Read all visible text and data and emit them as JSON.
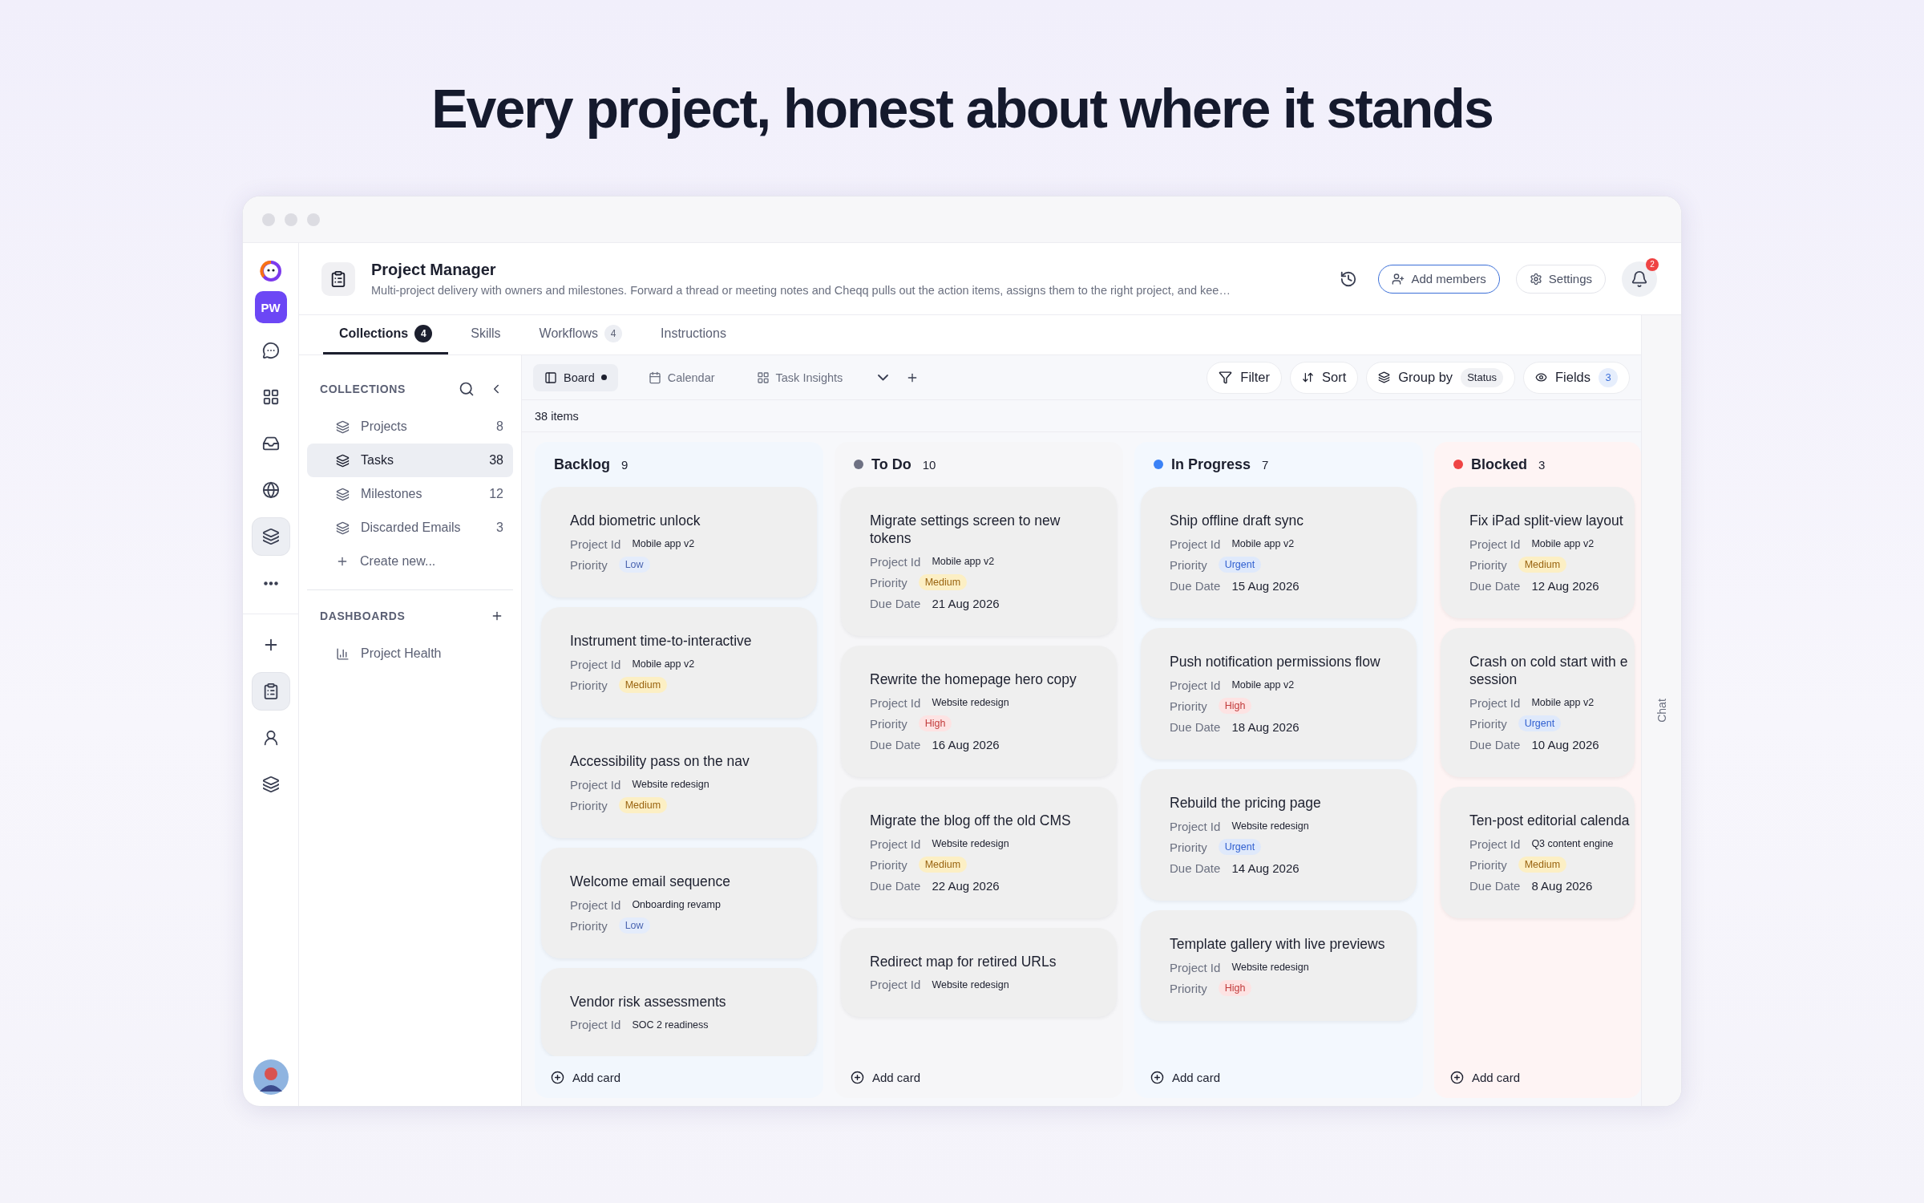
{
  "headline": "Every project, honest about where it stands",
  "rail": {
    "top": [
      {
        "kind": "logo"
      },
      {
        "kind": "initials",
        "text": "PW"
      },
      {
        "kind": "chat",
        "selected": false
      },
      {
        "kind": "grid",
        "selected": false
      },
      {
        "kind": "tray",
        "selected": false
      },
      {
        "kind": "globe",
        "selected": false
      },
      {
        "kind": "layers",
        "selected": true
      },
      {
        "kind": "more",
        "selected": false
      }
    ],
    "bottom": [
      {
        "kind": "plus",
        "selected": false
      },
      {
        "kind": "clipboard",
        "selected": true
      },
      {
        "kind": "user",
        "selected": false
      },
      {
        "kind": "layers",
        "selected": false
      }
    ]
  },
  "header": {
    "title": "Project Manager",
    "description": "Multi-project delivery with owners and milestones. Forward a thread or meeting notes and Cheqq pulls out the action items, assigns them to the right project, and kee…",
    "buttons": [
      "Add members",
      "Settings"
    ],
    "notifications": "2"
  },
  "tabs": [
    {
      "label": "Collections",
      "count": "4",
      "selected": true
    },
    {
      "label": "Skills",
      "selected": false
    },
    {
      "label": "Workflows",
      "count": "4",
      "selected": false
    },
    {
      "label": "Instructions",
      "selected": false
    }
  ],
  "sidebar": {
    "collections_title": "COLLECTIONS",
    "collections": [
      {
        "label": "Projects",
        "count": "8",
        "selected": false
      },
      {
        "label": "Tasks",
        "count": "38",
        "selected": true
      },
      {
        "label": "Milestones",
        "count": "12",
        "selected": false
      },
      {
        "label": "Discarded Emails",
        "count": "3",
        "selected": false
      }
    ],
    "create_label": "Create new...",
    "dashboards_title": "DASHBOARDS",
    "dashboards": [
      {
        "label": "Project Health"
      }
    ]
  },
  "views": [
    {
      "label": "Board",
      "kind": "board",
      "selected": true
    },
    {
      "label": "Calendar",
      "kind": "calendar",
      "selected": false
    },
    {
      "label": "Task Insights",
      "kind": "insights",
      "selected": false
    }
  ],
  "toolbar": [
    {
      "label": "Filter",
      "kind": "filter"
    },
    {
      "label": "Sort",
      "kind": "sort"
    },
    {
      "label": "Group by",
      "kind": "group",
      "chip": "Status"
    },
    {
      "label": "Fields",
      "kind": "fields",
      "chip": "3"
    }
  ],
  "item_count": "38 items",
  "columns": [
    {
      "name": "Backlog",
      "count": "9",
      "add_label": "Add card",
      "cards": [
        {
          "title": "Add biometric unlock",
          "fields": [
            {
              "label": "Project Id",
              "value": "Mobile app v2",
              "kind": "tag"
            },
            {
              "label": "Priority",
              "value": "Low",
              "kind": "low"
            }
          ]
        },
        {
          "title": "Instrument time-to-interactive",
          "fields": [
            {
              "label": "Project Id",
              "value": "Mobile app v2",
              "kind": "tag"
            },
            {
              "label": "Priority",
              "value": "Medium",
              "kind": "medium"
            }
          ]
        },
        {
          "title": "Accessibility pass on the nav",
          "fields": [
            {
              "label": "Project Id",
              "value": "Website redesign",
              "kind": "tag"
            },
            {
              "label": "Priority",
              "value": "Medium",
              "kind": "medium"
            }
          ]
        },
        {
          "title": "Welcome email sequence",
          "fields": [
            {
              "label": "Project Id",
              "value": "Onboarding revamp",
              "kind": "tag"
            },
            {
              "label": "Priority",
              "value": "Low",
              "kind": "low"
            }
          ]
        },
        {
          "title": "Vendor risk assessments",
          "fields": [
            {
              "label": "Project Id",
              "value": "SOC 2 readiness",
              "kind": "tag"
            }
          ]
        }
      ]
    },
    {
      "name": "To Do",
      "count": "10",
      "color": "#6e7183",
      "add_label": "Add card",
      "cards": [
        {
          "title": "Migrate settings screen to new tokens",
          "fields": [
            {
              "label": "Project Id",
              "value": "Mobile app v2",
              "kind": "tag"
            },
            {
              "label": "Priority",
              "value": "Medium",
              "kind": "medium"
            },
            {
              "label": "Due Date",
              "value": "21 Aug 2026",
              "kind": "plain"
            }
          ]
        },
        {
          "title": "Rewrite the homepage hero copy",
          "fields": [
            {
              "label": "Project Id",
              "value": "Website redesign",
              "kind": "tag"
            },
            {
              "label": "Priority",
              "value": "High",
              "kind": "high"
            },
            {
              "label": "Due Date",
              "value": "16 Aug 2026",
              "kind": "plain"
            }
          ]
        },
        {
          "title": "Migrate the blog off the old CMS",
          "fields": [
            {
              "label": "Project Id",
              "value": "Website redesign",
              "kind": "tag"
            },
            {
              "label": "Priority",
              "value": "Medium",
              "kind": "medium"
            },
            {
              "label": "Due Date",
              "value": "22 Aug 2026",
              "kind": "plain"
            }
          ]
        },
        {
          "title": "Redirect map for retired URLs",
          "fields": [
            {
              "label": "Project Id",
              "value": "Website redesign",
              "kind": "tag"
            }
          ]
        }
      ]
    },
    {
      "name": "In Progress",
      "count": "7",
      "color": "#3b82f6",
      "add_label": "Add card",
      "cards": [
        {
          "title": "Ship offline draft sync",
          "fields": [
            {
              "label": "Project Id",
              "value": "Mobile app v2",
              "kind": "tag"
            },
            {
              "label": "Priority",
              "value": "Urgent",
              "kind": "urgent"
            },
            {
              "label": "Due Date",
              "value": "15 Aug 2026",
              "kind": "plain"
            }
          ]
        },
        {
          "title": "Push notification permissions flow",
          "fields": [
            {
              "label": "Project Id",
              "value": "Mobile app v2",
              "kind": "tag"
            },
            {
              "label": "Priority",
              "value": "High",
              "kind": "high"
            },
            {
              "label": "Due Date",
              "value": "18 Aug 2026",
              "kind": "plain"
            }
          ]
        },
        {
          "title": "Rebuild the pricing page",
          "fields": [
            {
              "label": "Project Id",
              "value": "Website redesign",
              "kind": "tag"
            },
            {
              "label": "Priority",
              "value": "Urgent",
              "kind": "urgent"
            },
            {
              "label": "Due Date",
              "value": "14 Aug 2026",
              "kind": "plain"
            }
          ]
        },
        {
          "title": "Template gallery with live previews",
          "fields": [
            {
              "label": "Project Id",
              "value": "Website redesign",
              "kind": "tag"
            },
            {
              "label": "Priority",
              "value": "High",
              "kind": "high"
            }
          ]
        }
      ]
    },
    {
      "name": "Blocked",
      "count": "3",
      "color": "#ef4444",
      "add_label": "Add card",
      "cards": [
        {
          "title": "Fix iPad split-view layout",
          "fields": [
            {
              "label": "Project Id",
              "value": "Mobile app v2",
              "kind": "tag"
            },
            {
              "label": "Priority",
              "value": "Medium",
              "kind": "medium"
            },
            {
              "label": "Due Date",
              "value": "12 Aug 2026",
              "kind": "plain"
            }
          ]
        },
        {
          "title": "Crash on cold start with e\nsession",
          "fields": [
            {
              "label": "Project Id",
              "value": "Mobile app v2",
              "kind": "tag"
            },
            {
              "label": "Priority",
              "value": "Urgent",
              "kind": "urgent"
            },
            {
              "label": "Due Date",
              "value": "10 Aug 2026",
              "kind": "plain"
            }
          ]
        },
        {
          "title": "Ten-post editorial calenda",
          "fields": [
            {
              "label": "Project Id",
              "value": "Q3 content engine",
              "kind": "tag"
            },
            {
              "label": "Priority",
              "value": "Medium",
              "kind": "medium"
            },
            {
              "label": "Due Date",
              "value": "8 Aug 2026",
              "kind": "plain"
            }
          ]
        }
      ]
    }
  ],
  "chat_label": "Chat"
}
